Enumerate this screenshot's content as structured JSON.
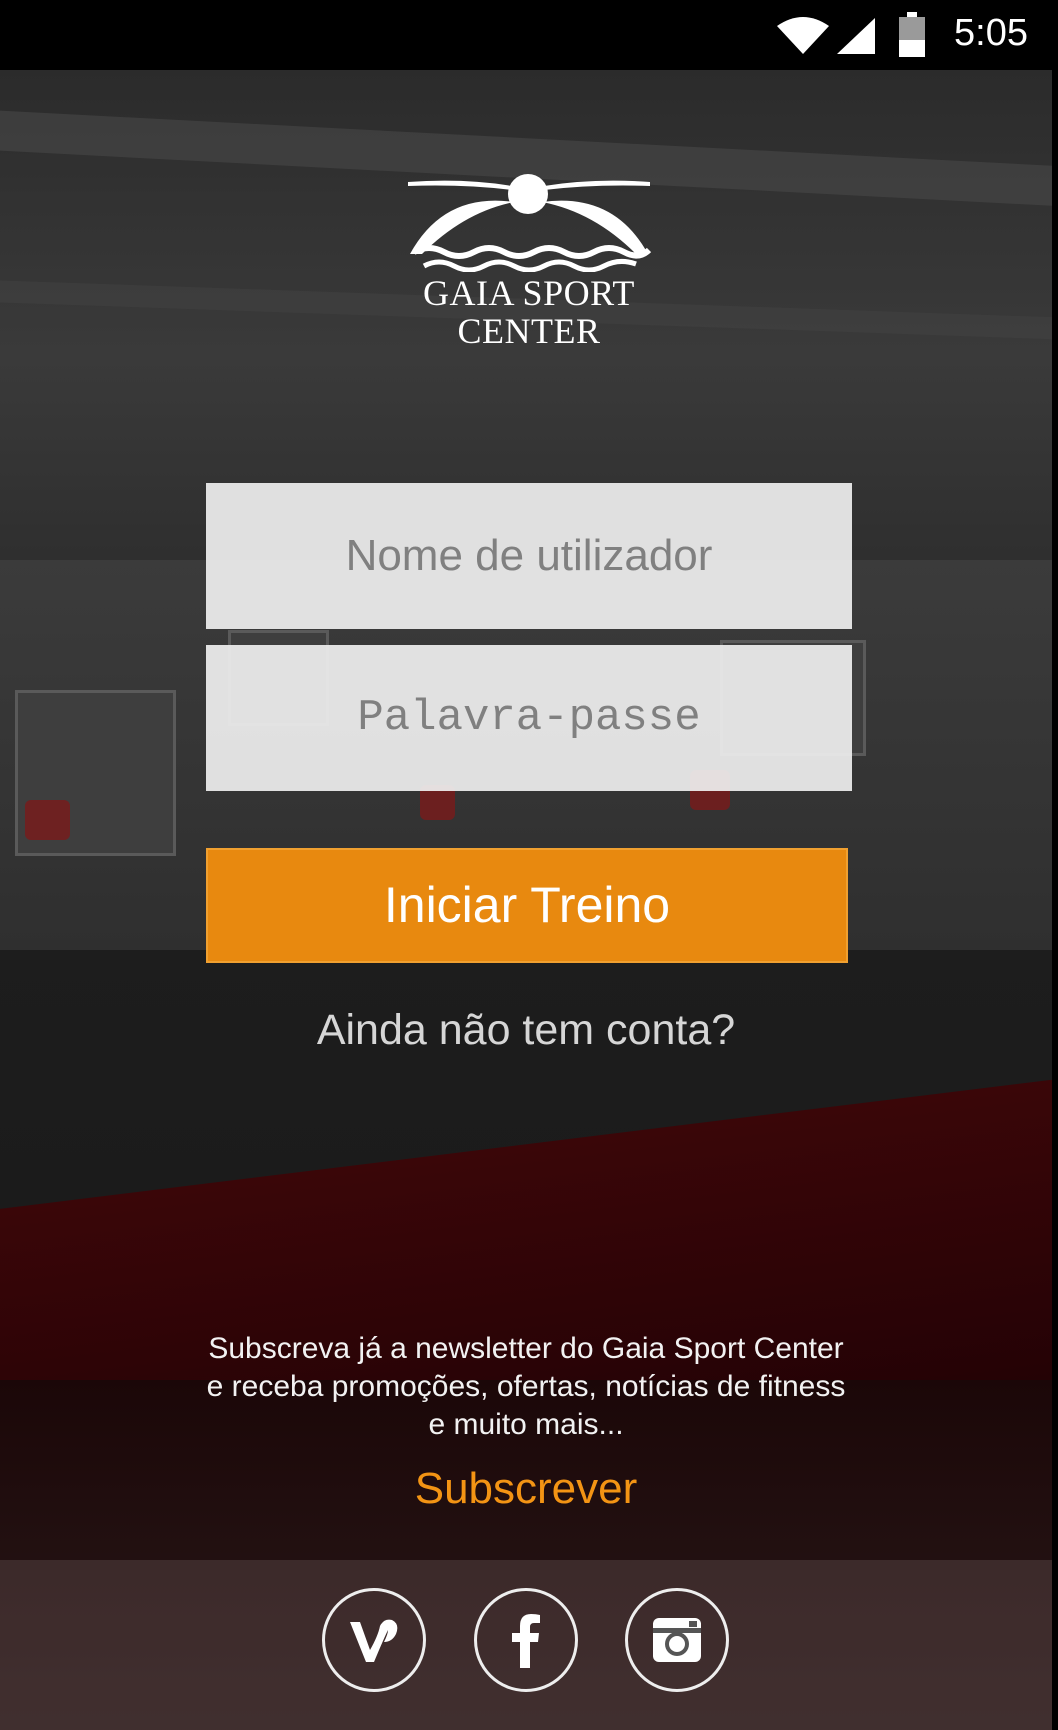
{
  "status_bar": {
    "time": "5:05"
  },
  "logo": {
    "line1": "GAIA SPORT",
    "line2": "CENTER"
  },
  "login": {
    "username_placeholder": "Nome de utilizador",
    "password_placeholder": "Palavra-passe",
    "submit_label": "Iniciar Treino",
    "signup_link": "Ainda não tem conta?"
  },
  "newsletter": {
    "text": "Subscreva já a newsletter do Gaia Sport Center e receba promoções, ofertas, notícias de fitness e muito mais...",
    "subscribe_label": "Subscrever"
  },
  "social": [
    {
      "icon": "vine-icon"
    },
    {
      "icon": "facebook-icon"
    },
    {
      "icon": "instagram-icon"
    }
  ],
  "colors": {
    "accent": "#e8890f",
    "link_accent": "#f39414"
  }
}
